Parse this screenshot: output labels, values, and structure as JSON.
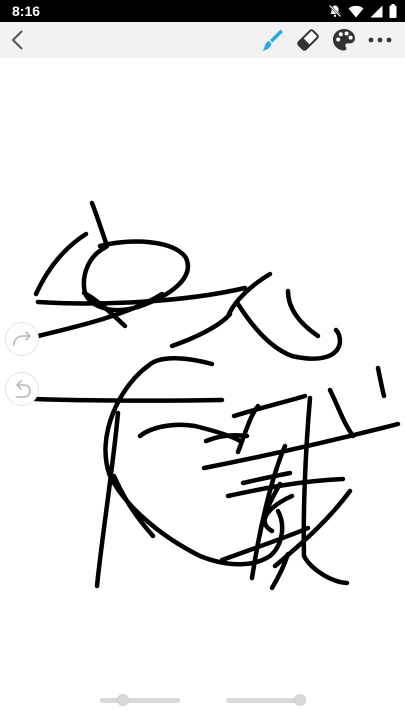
{
  "status_bar": {
    "time": "8:16",
    "icons": [
      "notifications-off-icon",
      "wifi-icon",
      "signal-icon",
      "battery-icon"
    ]
  },
  "toolbar": {
    "back_icon": "chevron-left-icon",
    "tools": [
      "brush-icon",
      "eraser-icon",
      "palette-icon",
      "more-icon"
    ],
    "active_tool": "brush-icon",
    "accent_color": "#29a9e1"
  },
  "side_controls": [
    "redo-icon",
    "undo-icon"
  ],
  "sliders": [
    {
      "name": "brush-size-slider",
      "value": 0.25
    },
    {
      "name": "opacity-slider",
      "value": 1.0
    }
  ],
  "drawing": {
    "stroke_color": "#000000"
  }
}
